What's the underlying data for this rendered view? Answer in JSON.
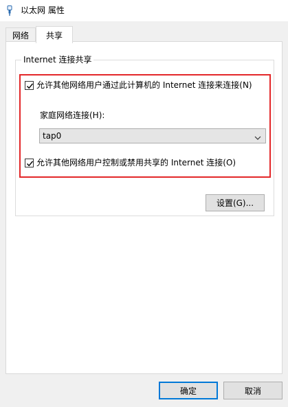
{
  "window": {
    "title": "以太网 属性",
    "icon": "network-adapter-icon"
  },
  "tabs": [
    {
      "label": "网络",
      "selected": false
    },
    {
      "label": "共享",
      "selected": true
    }
  ],
  "sharing": {
    "group_title": "Internet 连接共享",
    "allow_share_label": "允许其他网络用户通过此计算机的 Internet 连接来连接(N)",
    "allow_share_checked": true,
    "home_network_label": "家庭网络连接(H):",
    "home_network_value": "tap0",
    "allow_control_label": "允许其他网络用户控制或禁用共享的 Internet 连接(O)",
    "allow_control_checked": true,
    "settings_button": "设置(G)..."
  },
  "footer": {
    "ok_label": "确定",
    "cancel_label": "取消"
  },
  "colors": {
    "highlight_border": "#e32628",
    "ok_border": "#0078d7"
  }
}
